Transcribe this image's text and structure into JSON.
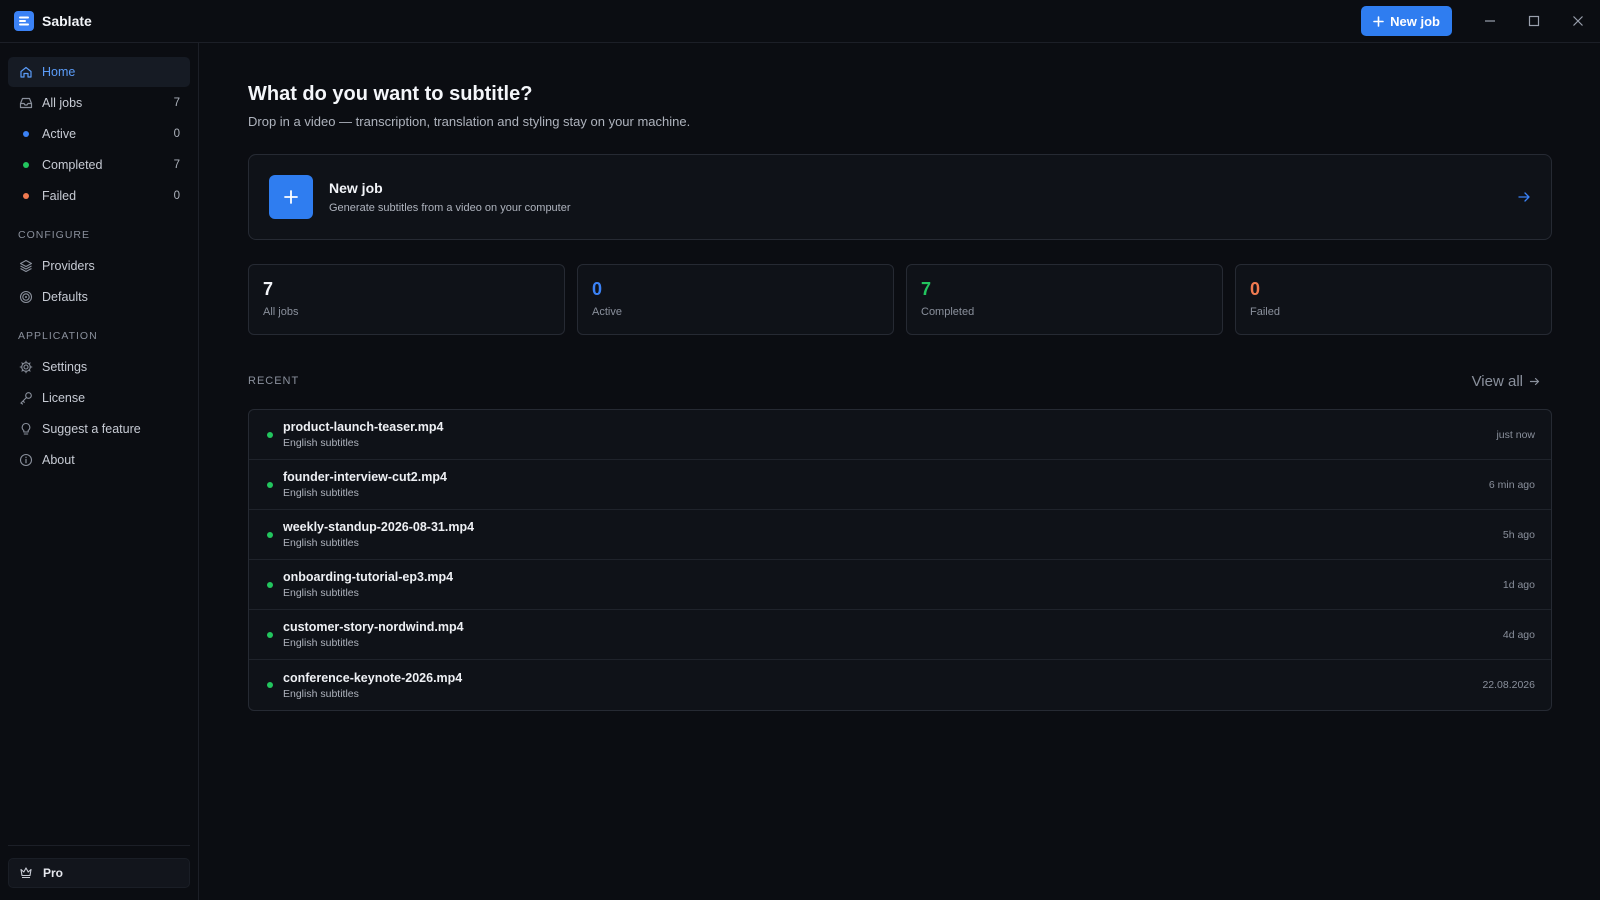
{
  "app": {
    "name": "Sablate"
  },
  "titlebar": {
    "new_job_label": "New job"
  },
  "colors": {
    "accent": "#2f7df0",
    "active": "#3b82f6",
    "completed": "#22c55e",
    "failed": "#f07a50"
  },
  "sidebar": {
    "nav": [
      {
        "label": "Home",
        "icon": "home-icon",
        "active": true
      },
      {
        "label": "All jobs",
        "icon": "inbox-icon",
        "count": "7"
      },
      {
        "label": "Active",
        "dot": "#3b82f6",
        "count": "0"
      },
      {
        "label": "Completed",
        "dot": "#22c55e",
        "count": "7"
      },
      {
        "label": "Failed",
        "dot": "#f07a50",
        "count": "0"
      }
    ],
    "configure_label": "CONFIGURE",
    "configure": [
      {
        "label": "Providers",
        "icon": "layers-icon"
      },
      {
        "label": "Defaults",
        "icon": "target-icon"
      }
    ],
    "application_label": "APPLICATION",
    "application": [
      {
        "label": "Settings",
        "icon": "gear-icon"
      },
      {
        "label": "License",
        "icon": "key-icon"
      },
      {
        "label": "Suggest a feature",
        "icon": "lightbulb-icon"
      },
      {
        "label": "About",
        "icon": "info-icon"
      }
    ],
    "pro_label": "Pro"
  },
  "main": {
    "title": "What do you want to subtitle?",
    "subtitle": "Drop in a video — transcription, translation and styling stay on your machine.",
    "new_job_card": {
      "title": "New job",
      "description": "Generate subtitles from a video on your computer"
    },
    "stats": [
      {
        "value": "7",
        "label": "All jobs",
        "color": "#f2f4f8"
      },
      {
        "value": "0",
        "label": "Active",
        "color": "#3b82f6"
      },
      {
        "value": "7",
        "label": "Completed",
        "color": "#22c55e"
      },
      {
        "value": "0",
        "label": "Failed",
        "color": "#f07a50"
      }
    ],
    "recent_label": "RECENT",
    "view_all_label": "View all",
    "recent": [
      {
        "name": "product-launch-teaser.mp4",
        "sub": "English subtitles",
        "time": "just now"
      },
      {
        "name": "founder-interview-cut2.mp4",
        "sub": "English subtitles",
        "time": "6 min ago"
      },
      {
        "name": "weekly-standup-2026-08-31.mp4",
        "sub": "English subtitles",
        "time": "5h ago"
      },
      {
        "name": "onboarding-tutorial-ep3.mp4",
        "sub": "English subtitles",
        "time": "1d ago"
      },
      {
        "name": "customer-story-nordwind.mp4",
        "sub": "English subtitles",
        "time": "4d ago"
      },
      {
        "name": "conference-keynote-2026.mp4",
        "sub": "English subtitles",
        "time": "22.08.2026"
      }
    ]
  }
}
